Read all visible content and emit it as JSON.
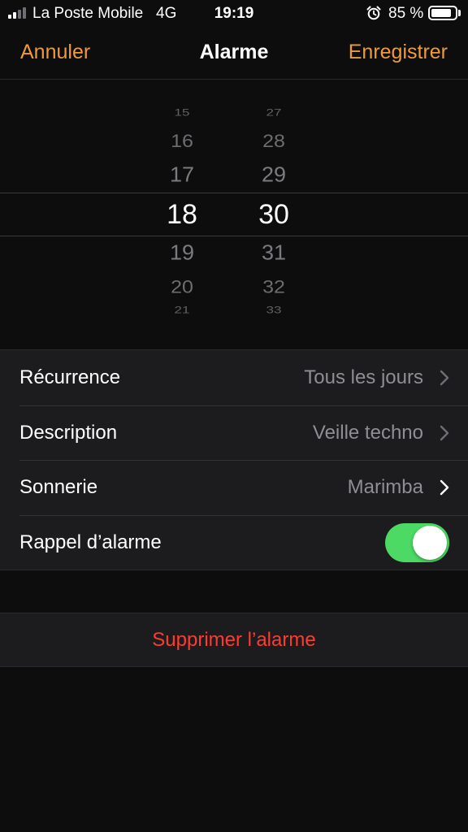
{
  "status_bar": {
    "carrier": "La Poste Mobile",
    "network": "4G",
    "time": "19:19",
    "battery_percent": "85 %",
    "battery_level": 0.85,
    "signal_bars": 2,
    "signal_bars_total": 4,
    "alarm_icon": "alarm-clock-icon"
  },
  "navbar": {
    "cancel_label": "Annuler",
    "title": "Alarme",
    "save_label": "Enregistrer"
  },
  "picker": {
    "hours": [
      "15",
      "16",
      "17",
      "18",
      "19",
      "20",
      "21"
    ],
    "minutes": [
      "27",
      "28",
      "29",
      "30",
      "31",
      "32",
      "33"
    ],
    "selected_hour": "18",
    "selected_minute": "30"
  },
  "settings": {
    "recurrence_label": "Récurrence",
    "recurrence_value": "Tous les jours",
    "description_label": "Description",
    "description_value": "Veille techno",
    "sound_label": "Sonnerie",
    "sound_value": "Marimba",
    "snooze_label": "Rappel d’alarme",
    "snooze_on": true
  },
  "delete_label": "Supprimer l’alarme",
  "colors": {
    "accent": "#f09a37",
    "destructive": "#ff3b30",
    "toggle_on": "#4cd964",
    "background": "#0d0d0d",
    "cell": "#1c1c1e"
  }
}
